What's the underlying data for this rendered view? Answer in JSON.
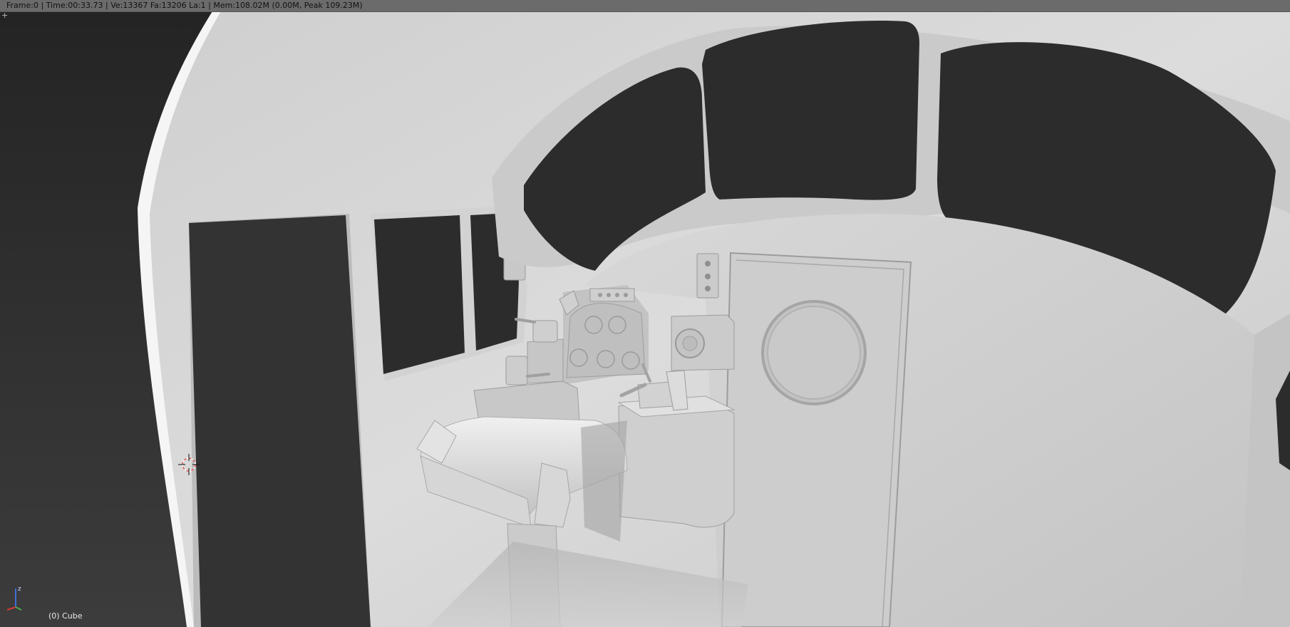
{
  "viewport": {
    "header": {
      "frame": "Frame:0",
      "time": "Time:00:33.73",
      "vertices": "Ve:13367",
      "faces": "Fa:13206",
      "layer": "La:1",
      "memory": "Mem:108.02M (0.00M, Peak 109.23M)",
      "full_text": "Frame:0 | Time:00:33.73 | Ve:13367 Fa:13206 La:1 | Mem:108.02M (0.00M, Peak 109.23M)"
    },
    "corner_widget_glyph": "+",
    "object_label": "(0) Cube",
    "axis_gizmo": {
      "axes": [
        "x",
        "y",
        "z"
      ],
      "x_color": "#d23a3a",
      "y_color": "#4caf50",
      "z_color": "#3f6fd8"
    },
    "scene_description_icons": [
      "3d-cursor-icon",
      "axis-gizmo-icon"
    ],
    "colors": {
      "background": "#2a2a2a",
      "header": "#6b6b6b",
      "model_light": "#d9d9d9",
      "model_mid": "#b9b9b9",
      "window_dark": "#2c2c2c"
    }
  }
}
